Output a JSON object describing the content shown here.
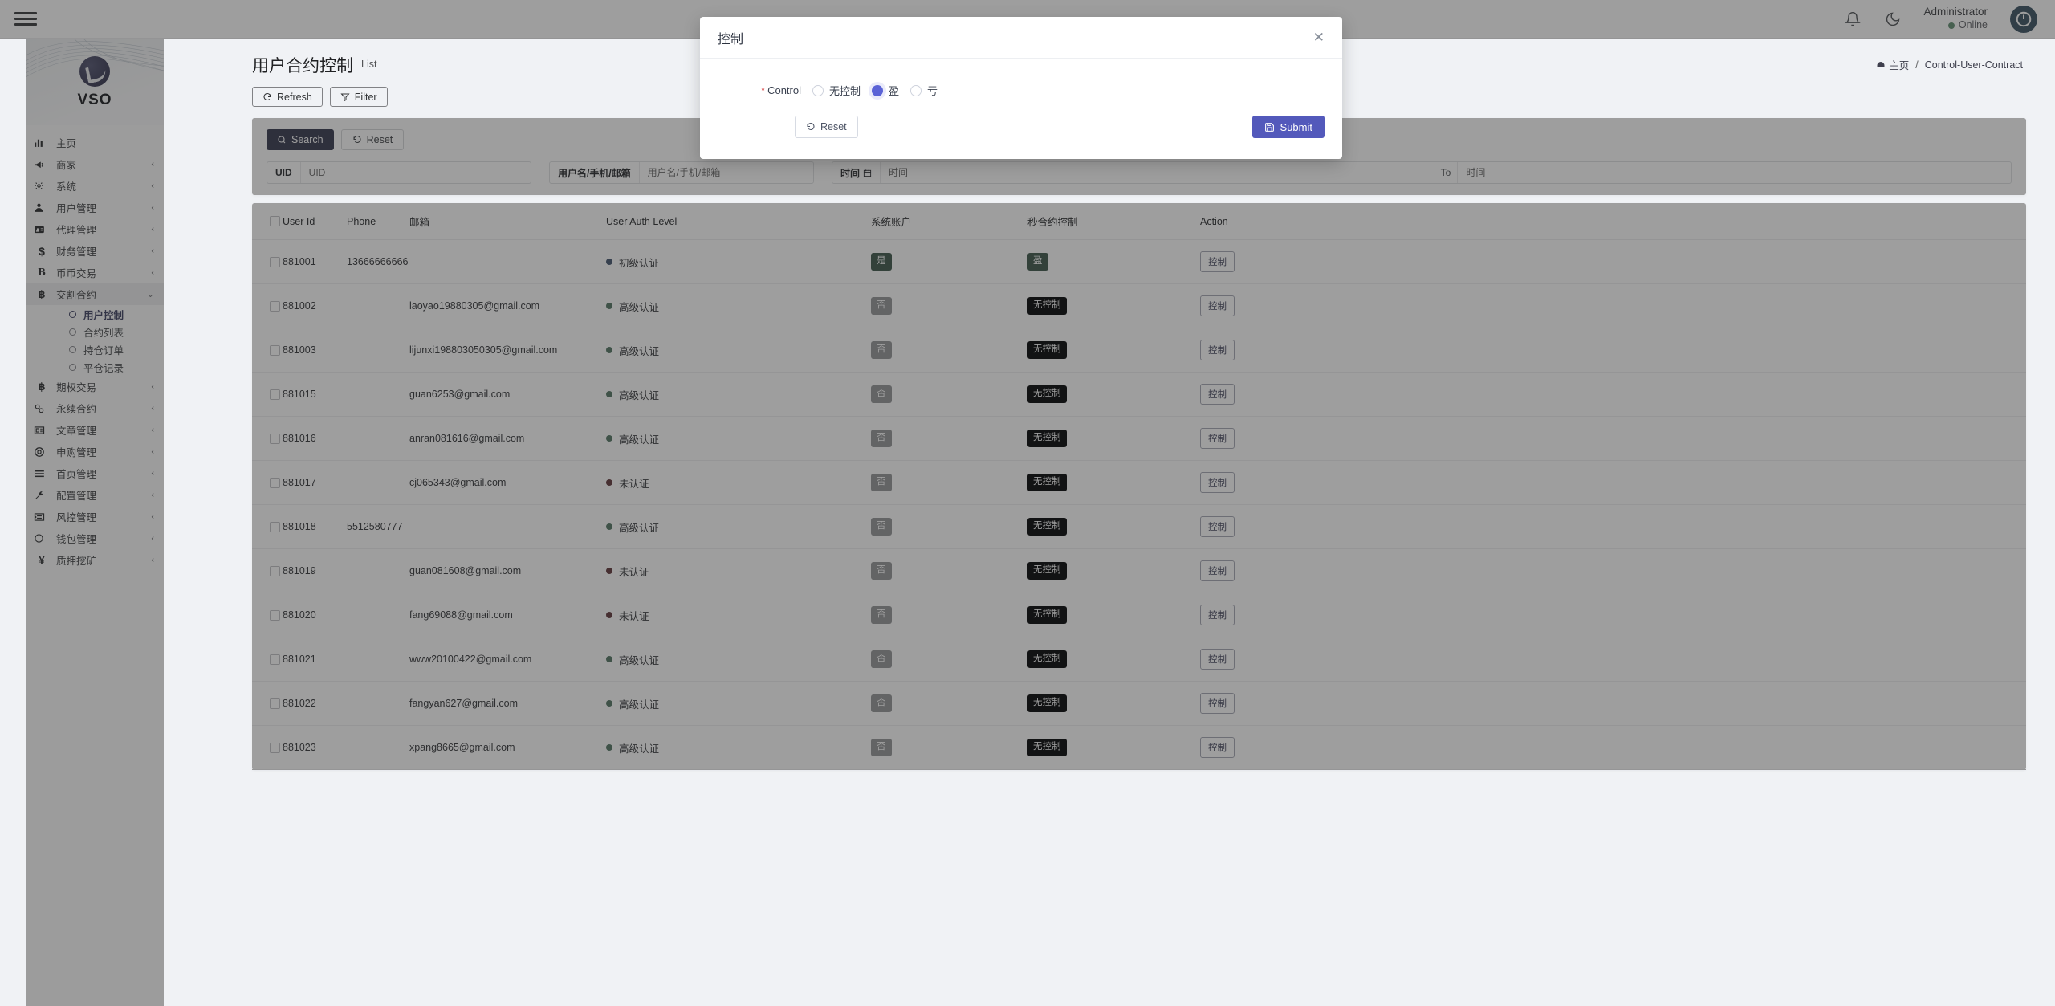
{
  "topbar": {
    "menu_icon": "hamburger-icon",
    "bell_icon": "bell-icon",
    "theme_icon": "moon-icon",
    "user_name": "Administrator",
    "user_status": "Online",
    "avatar_icon": "power-avatar-icon"
  },
  "sidebar": {
    "brand": "VSO",
    "items": [
      {
        "label": "主页",
        "icon": "chart-bar-icon",
        "expandable": false
      },
      {
        "label": "商家",
        "icon": "megaphone-icon",
        "expandable": true
      },
      {
        "label": "系统",
        "icon": "gear-icon",
        "expandable": true
      },
      {
        "label": "用户管理",
        "icon": "user-icon",
        "expandable": true
      },
      {
        "label": "代理管理",
        "icon": "id-card-icon",
        "expandable": true
      },
      {
        "label": "财务管理",
        "icon": "dollar-icon",
        "expandable": true
      },
      {
        "label": "币币交易",
        "icon": "bitcoin-b-icon",
        "expandable": true
      },
      {
        "label": "交割合约",
        "icon": "bitcoin-icon",
        "expandable": true,
        "open": true,
        "children": [
          {
            "label": "用户控制",
            "active": true
          },
          {
            "label": "合约列表",
            "active": false
          },
          {
            "label": "持仓订单",
            "active": false
          },
          {
            "label": "平仓记录",
            "active": false
          }
        ]
      },
      {
        "label": "期权交易",
        "icon": "bitcoin-icon",
        "expandable": true
      },
      {
        "label": "永续合约",
        "icon": "link-icon",
        "expandable": true
      },
      {
        "label": "文章管理",
        "icon": "news-icon",
        "expandable": true
      },
      {
        "label": "申购管理",
        "icon": "lifebuoy-icon",
        "expandable": true
      },
      {
        "label": "首页管理",
        "icon": "lines-icon",
        "expandable": true
      },
      {
        "label": "配置管理",
        "icon": "wrench-icon",
        "expandable": true
      },
      {
        "label": "风控管理",
        "icon": "indent-icon",
        "expandable": true
      },
      {
        "label": "钱包管理",
        "icon": "circle-icon",
        "expandable": true
      },
      {
        "label": "质押挖矿",
        "icon": "yen-icon",
        "expandable": true
      }
    ]
  },
  "page": {
    "title": "用户合约控制",
    "subtitle": "List",
    "breadcrumb_home": "主页",
    "breadcrumb_sep": "/",
    "breadcrumb_current": "Control-User-Contract",
    "refresh_label": "Refresh",
    "filter_label": "Filter"
  },
  "search": {
    "search_label": "Search",
    "reset_label": "Reset",
    "uid_label": "UID",
    "uid_placeholder": "UID",
    "uid_value": "",
    "user_label": "用户名/手机/邮箱",
    "user_placeholder": "用户名/手机/邮箱",
    "user_value": "",
    "time_label": "时间",
    "time_from_placeholder": "时间",
    "time_from_value": "",
    "time_to_label": "To",
    "time_to_placeholder": "时间",
    "time_to_value": ""
  },
  "table": {
    "columns": [
      "",
      "User Id",
      "Phone",
      "邮箱",
      "User Auth Level",
      "系统账户",
      "秒合约控制",
      "Action"
    ],
    "action_label": "控制",
    "rows": [
      {
        "user_id": "881001",
        "phone": "13666666666",
        "email": "",
        "auth": "初级认证",
        "auth_color": "#2a6ec4",
        "sys": "是",
        "sys_style": "b-green",
        "ctl": "盈",
        "ctl_style": "b-green"
      },
      {
        "user_id": "881002",
        "phone": "",
        "email": "laoyao19880305@gmail.com",
        "auth": "高级认证",
        "auth_color": "#1d9d5c",
        "sys": "否",
        "sys_style": "b-gray",
        "ctl": "无控制",
        "ctl_style": "b-dark"
      },
      {
        "user_id": "881003",
        "phone": "",
        "email": "lijunxi198803050305@gmail.com",
        "auth": "高级认证",
        "auth_color": "#1d9d5c",
        "sys": "否",
        "sys_style": "b-gray",
        "ctl": "无控制",
        "ctl_style": "b-dark"
      },
      {
        "user_id": "881015",
        "phone": "",
        "email": "guan6253@gmail.com",
        "auth": "高级认证",
        "auth_color": "#1d9d5c",
        "sys": "否",
        "sys_style": "b-gray",
        "ctl": "无控制",
        "ctl_style": "b-dark"
      },
      {
        "user_id": "881016",
        "phone": "",
        "email": "anran081616@gmail.com",
        "auth": "高级认证",
        "auth_color": "#1d9d5c",
        "sys": "否",
        "sys_style": "b-gray",
        "ctl": "无控制",
        "ctl_style": "b-dark"
      },
      {
        "user_id": "881017",
        "phone": "",
        "email": "cj065343@gmail.com",
        "auth": "未认证",
        "auth_color": "#c6343f",
        "sys": "否",
        "sys_style": "b-gray",
        "ctl": "无控制",
        "ctl_style": "b-dark"
      },
      {
        "user_id": "881018",
        "phone": "5512580777",
        "email": "",
        "auth": "高级认证",
        "auth_color": "#1d9d5c",
        "sys": "否",
        "sys_style": "b-gray",
        "ctl": "无控制",
        "ctl_style": "b-dark"
      },
      {
        "user_id": "881019",
        "phone": "",
        "email": "guan081608@gmail.com",
        "auth": "未认证",
        "auth_color": "#c6343f",
        "sys": "否",
        "sys_style": "b-gray",
        "ctl": "无控制",
        "ctl_style": "b-dark"
      },
      {
        "user_id": "881020",
        "phone": "",
        "email": "fang69088@gmail.com",
        "auth": "未认证",
        "auth_color": "#c6343f",
        "sys": "否",
        "sys_style": "b-gray",
        "ctl": "无控制",
        "ctl_style": "b-dark"
      },
      {
        "user_id": "881021",
        "phone": "",
        "email": "www20100422@gmail.com",
        "auth": "高级认证",
        "auth_color": "#1d9d5c",
        "sys": "否",
        "sys_style": "b-gray",
        "ctl": "无控制",
        "ctl_style": "b-dark"
      },
      {
        "user_id": "881022",
        "phone": "",
        "email": "fangyan627@gmail.com",
        "auth": "高级认证",
        "auth_color": "#1d9d5c",
        "sys": "否",
        "sys_style": "b-gray",
        "ctl": "无控制",
        "ctl_style": "b-dark"
      },
      {
        "user_id": "881023",
        "phone": "",
        "email": "xpang8665@gmail.com",
        "auth": "高级认证",
        "auth_color": "#1d9d5c",
        "sys": "否",
        "sys_style": "b-gray",
        "ctl": "无控制",
        "ctl_style": "b-dark"
      }
    ]
  },
  "modal": {
    "title": "控制",
    "close_icon": "close-icon",
    "field_label": "Control",
    "required_mark": "*",
    "options": [
      {
        "label": "无控制",
        "selected": false
      },
      {
        "label": "盈",
        "selected": true
      },
      {
        "label": "亏",
        "selected": false
      }
    ],
    "reset_label": "Reset",
    "submit_label": "Submit"
  },
  "colors": {
    "accent": "#5359bb",
    "primary_button": "#404a9c",
    "radio_selected": "#5b63d6",
    "success": "#1d7a4f",
    "danger": "#c6343f",
    "online": "#19b955"
  }
}
